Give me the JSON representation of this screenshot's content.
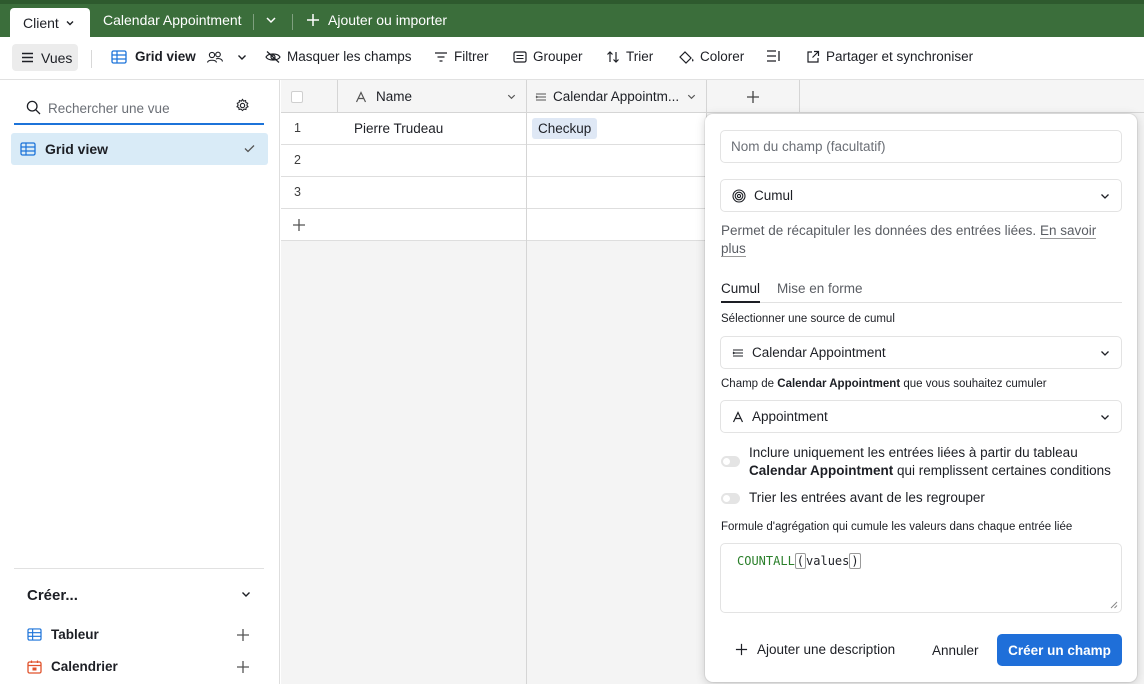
{
  "tabs": {
    "active": "Client",
    "other": "Calendar Appointment",
    "add": "Ajouter ou importer"
  },
  "toolbar": {
    "vues": "Vues",
    "grid_view": "Grid view",
    "hide_fields": "Masquer les champs",
    "filter": "Filtrer",
    "group": "Grouper",
    "sort": "Trier",
    "color": "Colorer",
    "share": "Partager et synchroniser"
  },
  "sidebar": {
    "search_placeholder": "Rechercher une vue",
    "views": [
      {
        "label": "Grid view"
      }
    ],
    "create_title": "Créer...",
    "create_items": [
      {
        "label": "Tableur"
      },
      {
        "label": "Calendrier"
      }
    ]
  },
  "grid": {
    "columns": [
      {
        "label": "Name"
      },
      {
        "label": "Calendar Appointm..."
      }
    ],
    "rows": [
      {
        "num": "1",
        "name": "Pierre Trudeau",
        "appointment": "Checkup"
      },
      {
        "num": "2",
        "name": "",
        "appointment": ""
      },
      {
        "num": "3",
        "name": "",
        "appointment": ""
      }
    ]
  },
  "panel": {
    "name_placeholder": "Nom du champ (facultatif)",
    "field_type": "Cumul",
    "description": "Permet de récapituler les données des entrées liées.",
    "learn_more": "En savoir plus",
    "tabs": [
      "Cumul",
      "Mise en forme"
    ],
    "source_label": "Sélectionner une source de cumul",
    "source_value": "Calendar Appointment",
    "field_label_prefix": "Champ de",
    "field_label_table": "Calendar Appointment",
    "field_label_suffix": "que vous souhaitez cumuler",
    "field_value": "Appointment",
    "toggle1_prefix": "Inclure uniquement les entrées liées à partir du tableau",
    "toggle1_table": "Calendar Appointment",
    "toggle1_suffix": "qui remplissent certaines conditions",
    "toggle2": "Trier les entrées avant de les regrouper",
    "formula_label": "Formule d'agrégation qui cumule les valeurs dans chaque entrée liée",
    "formula_fn": "COUNTALL",
    "formula_arg": "values",
    "add_description": "Ajouter une description",
    "cancel": "Annuler",
    "create": "Créer un champ"
  },
  "colors": {
    "tabbar": "#3b6e3b",
    "accent": "#1f6fd9",
    "selected_view": "#d9ebf7",
    "chip": "#dfe8f5"
  }
}
